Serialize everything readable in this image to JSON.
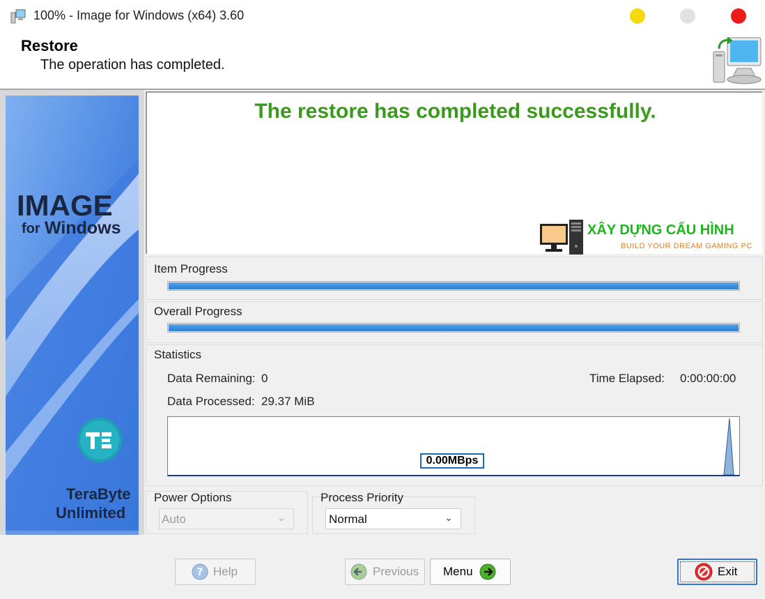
{
  "window": {
    "title": "100% - Image for Windows (x64) 3.60",
    "controls": [
      "minimize-button",
      "maximize-button",
      "close-button"
    ]
  },
  "header": {
    "title": "Restore",
    "subtitle": "The operation has completed."
  },
  "sidebar": {
    "logo_main": "IMAGE",
    "logo_for": "for",
    "logo_windows": "Windows",
    "company_line1": "TeraByte",
    "company_line2": "Unlimited"
  },
  "status": {
    "message": "The restore has completed successfully.",
    "message_color": "#3b9a1e"
  },
  "watermark": {
    "title": "XÂY DỰNG CẤU HÌNH",
    "subtitle": "BUILD YOUR DREAM GAMING PC"
  },
  "progress": {
    "item_label": "Item Progress",
    "item_fraction": 1.0,
    "overall_label": "Overall Progress",
    "overall_fraction": 1.0
  },
  "statistics": {
    "group_label": "Statistics",
    "data_remaining_label": "Data Remaining:",
    "data_remaining_value": "0",
    "time_elapsed_label": "Time Elapsed:",
    "time_elapsed_value": "0:00:00:00",
    "data_processed_label": "Data Processed:",
    "data_processed_value": "29.37 MiB",
    "speed": "0.00MBps"
  },
  "options": {
    "power_label": "Power Options",
    "power_value": "Auto",
    "priority_label": "Process Priority",
    "priority_value": "Normal"
  },
  "buttons": {
    "help": "Help",
    "previous": "Previous",
    "menu": "Menu",
    "exit": "Exit"
  },
  "colors": {
    "accent": "#2b78d6",
    "sidebar": "#3c78d8",
    "progress": "#3b8fdf",
    "close": "#ee1b1b",
    "minimize": "#f5d90a"
  }
}
